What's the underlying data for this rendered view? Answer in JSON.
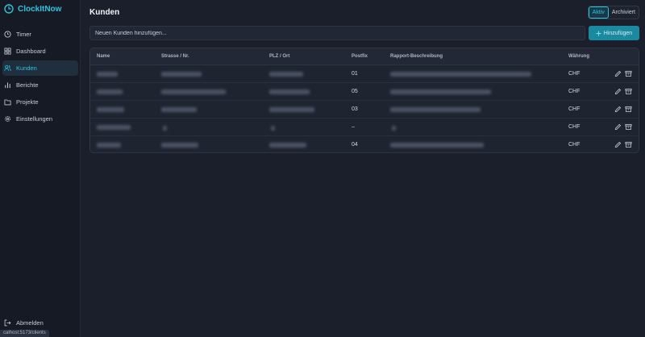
{
  "app": {
    "name": "ClockItNow"
  },
  "sidebar": {
    "items": [
      {
        "label": "Timer",
        "icon": "clock-icon",
        "active": false
      },
      {
        "label": "Dashboard",
        "icon": "grid-icon",
        "active": false
      },
      {
        "label": "Kunden",
        "icon": "users-icon",
        "active": true
      },
      {
        "label": "Berichte",
        "icon": "bar-chart-icon",
        "active": false
      },
      {
        "label": "Projekte",
        "icon": "folder-icon",
        "active": false
      },
      {
        "label": "Einstellungen",
        "icon": "gear-icon",
        "active": false
      }
    ],
    "logout_label": "Abmelden"
  },
  "status_url": "calhost:5173/clients",
  "page": {
    "title": "Kunden"
  },
  "filter": {
    "active_label": "Aktiv",
    "archived_label": "Archiviert",
    "selected": "Aktiv"
  },
  "add": {
    "placeholder": "Neuen Kunden hinzufügen...",
    "button_label": "Hinzufügen",
    "button_icon": "plus-icon"
  },
  "table": {
    "columns": [
      "Name",
      "Strasse / Nr.",
      "PLZ / Ort",
      "Postfix",
      "Rapport-Beschreibung",
      "Währung"
    ],
    "rows": [
      {
        "postfix": "01",
        "currency": "CHF"
      },
      {
        "postfix": "05",
        "currency": "CHF"
      },
      {
        "postfix": "03",
        "currency": "CHF"
      },
      {
        "postfix": "–",
        "currency": "CHF"
      },
      {
        "postfix": "04",
        "currency": "CHF"
      }
    ]
  },
  "colors": {
    "accent": "#2ec4e0",
    "background": "#1b1f2b",
    "sidebar": "#161a24",
    "button": "#1b8aa0"
  }
}
